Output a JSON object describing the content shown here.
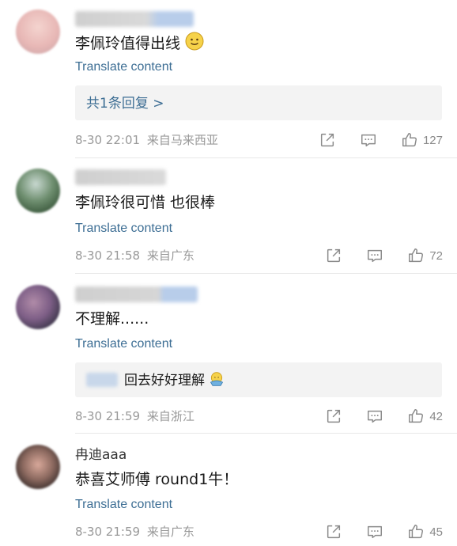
{
  "colors": {
    "link": "#3d6e94",
    "meta": "#999999",
    "reply_bg": "#f3f3f3",
    "divider": "#e8e8e8"
  },
  "comments": [
    {
      "text": "李佩玲值得出线",
      "emoji": "smile-emoji",
      "translate": "Translate content",
      "reply_summary": "共1条回复 >",
      "time": "8-30 22:01",
      "location": "来自马来西亚",
      "likes": "127"
    },
    {
      "text": "李佩玲很可惜 也很棒",
      "translate": "Translate content",
      "time": "8-30 21:58",
      "location": "来自广东",
      "likes": "72"
    },
    {
      "text": "不理解......",
      "translate": "Translate content",
      "reply_preview": "回去好好理解",
      "reply_emoji": "hug-emoji",
      "time": "8-30 21:59",
      "location": "来自浙江",
      "likes": "42"
    },
    {
      "username": "冉迪aaa",
      "text": "恭喜艾师傅 round1牛！",
      "translate": "Translate content",
      "time": "8-30 21:59",
      "location": "来自广东",
      "likes": "45"
    }
  ]
}
